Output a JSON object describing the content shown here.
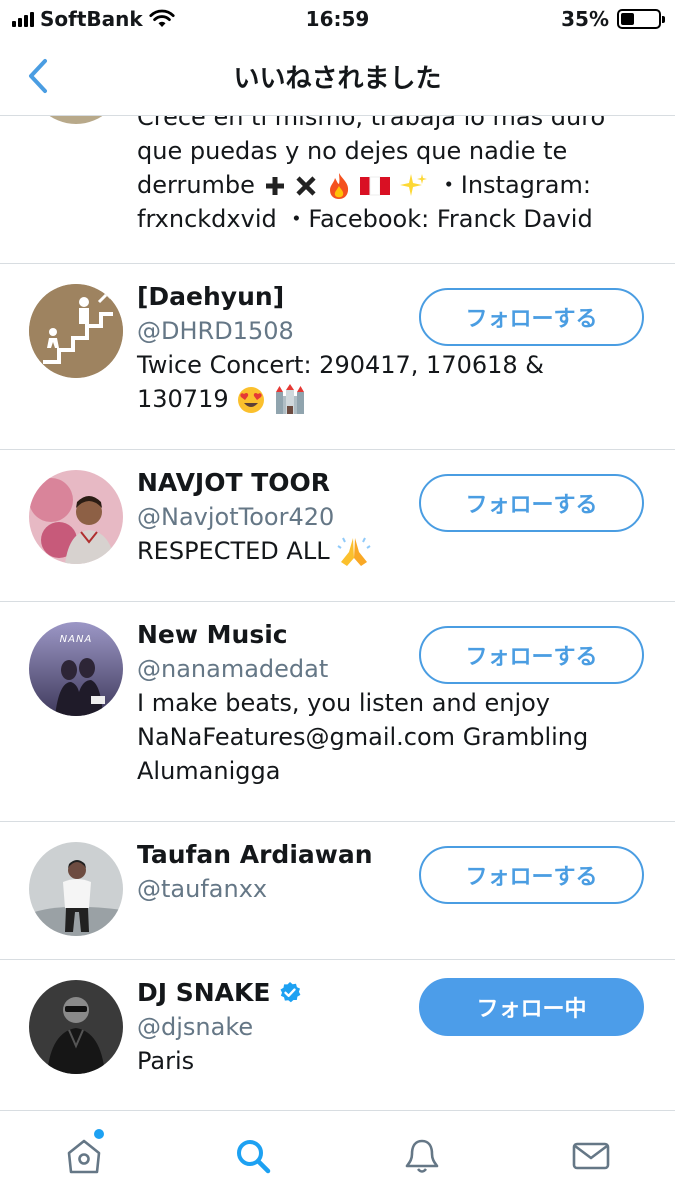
{
  "status_bar": {
    "carrier": "SoftBank",
    "time": "16:59",
    "battery_percent": "35%",
    "battery_level": 0.35
  },
  "nav": {
    "title": "いいねされました"
  },
  "colors": {
    "accent": "#4a9de2",
    "text_primary": "#14171a",
    "text_secondary": "#657786",
    "divider": "#d8dde1"
  },
  "partial_row": {
    "bio_line_1": "Crece en ti mismo, trabaja lo más duro",
    "bio_line_2": "que puedas y no dejes que nadie te",
    "bio_line_3_text": "derrumbe",
    "bio_line_3_tail": "・Instagram:",
    "bio_line_4": "frxnckdxvid ・Facebook: Franck David"
  },
  "users": [
    {
      "name": "[Daehyun]",
      "handle": "@DHRD1508",
      "bio_line_1": "Twice Concert: 290417, 170618 &",
      "bio_line_2": "130719",
      "button_label": "フォローする",
      "avatar_icon": "stairs-logo"
    },
    {
      "name": "NAVJOT TOOR",
      "handle": "@NavjotToor420",
      "bio_line_1": "RESPECTED ALL",
      "button_label": "フォローする",
      "avatar_icon": "person-photo"
    },
    {
      "name": "New Music",
      "handle": "@nanamadedat",
      "bio_line_1": "I make beats, you listen and enjoy",
      "bio_line_2": "NaNaFeatures@gmail.com Grambling",
      "bio_line_3": "Alumanigga",
      "avatar_caption": "NANA",
      "button_label": "フォローする",
      "avatar_icon": "album-cover"
    },
    {
      "name": "Taufan Ardiawan",
      "handle": "@taufanxx",
      "button_label": "フォローする",
      "avatar_icon": "person-photo"
    },
    {
      "name": "DJ SNAKE",
      "handle": "@djsnake",
      "bio_line_1": "Paris",
      "verified": true,
      "button_label": "フォロー中",
      "avatar_icon": "person-photo"
    }
  ],
  "tabs": [
    {
      "name": "home",
      "icon": "home-icon",
      "has_notification_dot": true
    },
    {
      "name": "search",
      "icon": "search-icon",
      "active": true
    },
    {
      "name": "notifications",
      "icon": "bell-icon"
    },
    {
      "name": "messages",
      "icon": "mail-icon"
    }
  ]
}
